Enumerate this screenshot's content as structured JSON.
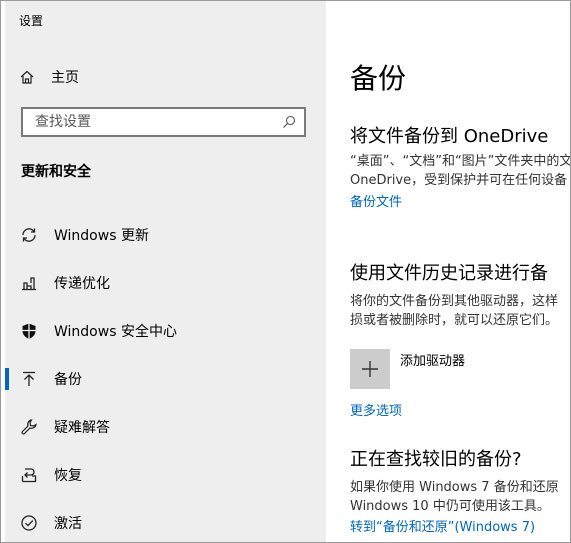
{
  "window": {
    "title": "设置"
  },
  "sidebar": {
    "home_label": "主页",
    "search_placeholder": "查找设置",
    "section_title": "更新和安全",
    "items": [
      {
        "label": "Windows 更新",
        "icon": "refresh-icon"
      },
      {
        "label": "传递优化",
        "icon": "delivery-optimization-icon"
      },
      {
        "label": "Windows 安全中心",
        "icon": "shield-icon"
      },
      {
        "label": "备份",
        "icon": "backup-arrow-icon",
        "active": true
      },
      {
        "label": "疑难解答",
        "icon": "wrench-icon"
      },
      {
        "label": "恢复",
        "icon": "recovery-icon"
      },
      {
        "label": "激活",
        "icon": "check-circle-icon"
      }
    ]
  },
  "main": {
    "title": "备份",
    "onedrive": {
      "heading": "将文件备份到 OneDrive",
      "desc_line1": "“桌面”、“文档”和“图片”文件夹中的文",
      "desc_line2": "OneDrive，受到保护并可在任何设备",
      "link": "备份文件"
    },
    "history": {
      "heading": "使用文件历史记录进行备",
      "desc_line1": "将你的文件备份到其他驱动器，这样",
      "desc_line2": "损或者被删除时，就可以还原它们。",
      "add_drive_label": "添加驱动器",
      "more_options": "更多选项"
    },
    "older": {
      "heading": "正在查找较旧的备份?",
      "desc_line1": "如果你使用 Windows 7 备份和还原",
      "desc_line2": "Windows 10 中仍可使用该工具。",
      "link": "转到“备份和还原”(Windows 7)"
    }
  },
  "colors": {
    "accent": "#0067c0",
    "sidebar_bg": "#eeeeee"
  }
}
